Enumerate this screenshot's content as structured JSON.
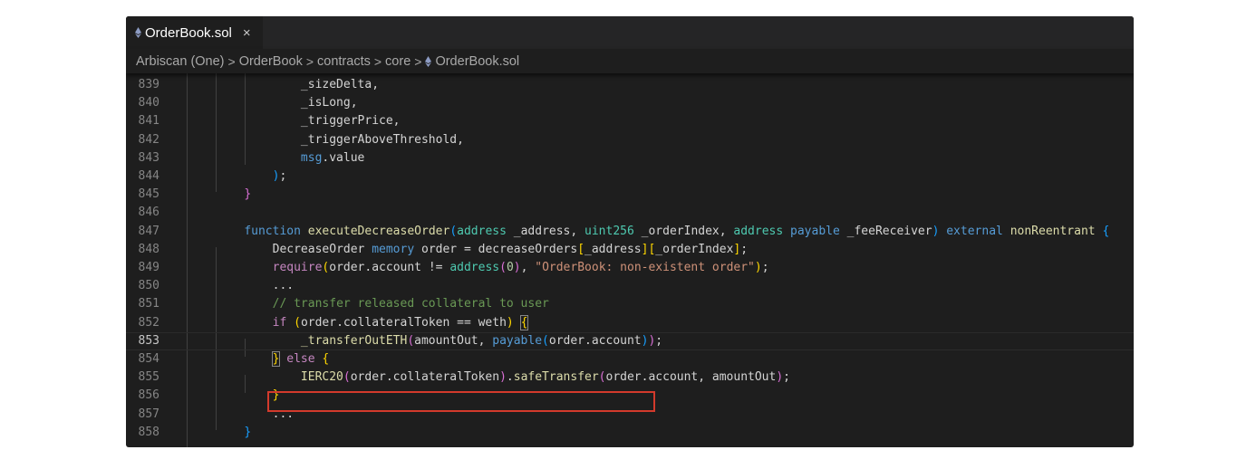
{
  "tab": {
    "filename": "OrderBook.sol",
    "close_glyph": "×",
    "icon": "ethereum-icon"
  },
  "breadcrumb": {
    "items": [
      "Arbiscan (One)",
      "OrderBook",
      "contracts",
      "core",
      "OrderBook.sol"
    ],
    "separator": ">"
  },
  "editor": {
    "current_line": 853,
    "lines": [
      {
        "n": "839",
        "indent": "            ",
        "tokens": [
          [
            "_sizeDelta",
            ""
          ],
          [
            ",",
            ""
          ]
        ]
      },
      {
        "n": "840",
        "indent": "            ",
        "tokens": [
          [
            "_isLong",
            ""
          ],
          [
            ",",
            ""
          ]
        ]
      },
      {
        "n": "841",
        "indent": "            ",
        "tokens": [
          [
            "_triggerPrice",
            ""
          ],
          [
            ",",
            ""
          ]
        ]
      },
      {
        "n": "842",
        "indent": "            ",
        "tokens": [
          [
            "_triggerAboveThreshold",
            ""
          ],
          [
            ",",
            ""
          ]
        ]
      },
      {
        "n": "843",
        "indent": "            ",
        "tokens": [
          [
            "msg",
            "kw"
          ],
          [
            ".value",
            ""
          ]
        ]
      },
      {
        "n": "844",
        "indent": "        ",
        "tokens": [
          [
            ")",
            "b3"
          ],
          [
            ";",
            ""
          ]
        ]
      },
      {
        "n": "845",
        "indent": "    ",
        "tokens": [
          [
            "}",
            "b2"
          ]
        ]
      },
      {
        "n": "846",
        "indent": "",
        "tokens": []
      },
      {
        "n": "847",
        "indent": "    ",
        "tokens": [
          [
            "function",
            "kw"
          ],
          [
            " ",
            ""
          ],
          [
            "executeDecreaseOrder",
            "fn"
          ],
          [
            "(",
            "b3"
          ],
          [
            "address",
            "ty"
          ],
          [
            " _address, ",
            ""
          ],
          [
            "uint256",
            "ty"
          ],
          [
            " _orderIndex, ",
            ""
          ],
          [
            "address",
            "ty"
          ],
          [
            " ",
            ""
          ],
          [
            "payable",
            "kw"
          ],
          [
            " _feeReceiver",
            ""
          ],
          [
            ")",
            "b3"
          ],
          [
            " ",
            ""
          ],
          [
            "external",
            "kw"
          ],
          [
            " ",
            ""
          ],
          [
            "nonReentrant",
            "fn"
          ],
          [
            " ",
            ""
          ],
          [
            "{",
            "b3"
          ]
        ]
      },
      {
        "n": "848",
        "indent": "        ",
        "tokens": [
          [
            "DecreaseOrder",
            ""
          ],
          [
            " ",
            ""
          ],
          [
            "memory",
            "kw"
          ],
          [
            " order = decreaseOrders",
            ""
          ],
          [
            "[",
            "b1"
          ],
          [
            "_address",
            ""
          ],
          [
            "]",
            "b1"
          ],
          [
            "[",
            "b1"
          ],
          [
            "_orderIndex",
            ""
          ],
          [
            "]",
            "b1"
          ],
          [
            ";",
            ""
          ]
        ]
      },
      {
        "n": "849",
        "indent": "        ",
        "tokens": [
          [
            "require",
            "ctl"
          ],
          [
            "(",
            "b1"
          ],
          [
            "order.account != ",
            ""
          ],
          [
            "address",
            "ty"
          ],
          [
            "(",
            "b2"
          ],
          [
            "0",
            "num"
          ],
          [
            ")",
            "b2"
          ],
          [
            ", ",
            ""
          ],
          [
            "\"OrderBook: non-existent order\"",
            "str"
          ],
          [
            ")",
            "b1"
          ],
          [
            ";",
            ""
          ]
        ]
      },
      {
        "n": "850",
        "indent": "        ",
        "tokens": [
          [
            "...",
            ""
          ]
        ]
      },
      {
        "n": "851",
        "indent": "        ",
        "tokens": [
          [
            "// transfer released collateral to user",
            "cm"
          ]
        ]
      },
      {
        "n": "852",
        "indent": "        ",
        "tokens": [
          [
            "if",
            "ctl"
          ],
          [
            " ",
            ""
          ],
          [
            "(",
            "b1"
          ],
          [
            "order.collateralToken == weth",
            ""
          ],
          [
            ")",
            "b1"
          ],
          [
            " ",
            ""
          ],
          [
            "{",
            "b1 bm"
          ]
        ]
      },
      {
        "n": "853",
        "indent": "            ",
        "tokens": [
          [
            "_transferOutETH",
            "fn"
          ],
          [
            "(",
            "b2"
          ],
          [
            "amountOut, ",
            ""
          ],
          [
            "payable",
            "kw"
          ],
          [
            "(",
            "b3"
          ],
          [
            "order.account",
            ""
          ],
          [
            ")",
            "b3"
          ],
          [
            ")",
            "b2"
          ],
          [
            ";",
            ""
          ]
        ]
      },
      {
        "n": "854",
        "indent": "        ",
        "tokens": [
          [
            "}",
            "b1 bm"
          ],
          [
            " ",
            ""
          ],
          [
            "else",
            "ctl"
          ],
          [
            " ",
            ""
          ],
          [
            "{",
            "b1"
          ]
        ]
      },
      {
        "n": "855",
        "indent": "            ",
        "tokens": [
          [
            "IERC20",
            "fn"
          ],
          [
            "(",
            "b2"
          ],
          [
            "order.collateralToken",
            ""
          ],
          [
            ")",
            "b2"
          ],
          [
            ".",
            ""
          ],
          [
            "safeTransfer",
            "fn"
          ],
          [
            "(",
            "b2"
          ],
          [
            "order.account, amountOut",
            ""
          ],
          [
            ")",
            "b2"
          ],
          [
            ";",
            ""
          ]
        ]
      },
      {
        "n": "856",
        "indent": "        ",
        "tokens": [
          [
            "}",
            "b1"
          ]
        ]
      },
      {
        "n": "857",
        "indent": "        ",
        "tokens": [
          [
            "...",
            ""
          ]
        ]
      },
      {
        "n": "858",
        "indent": "    ",
        "tokens": [
          [
            "}",
            "b3"
          ]
        ]
      }
    ]
  },
  "colors": {
    "highlight_box": "#d33a2c",
    "editor_background": "#1e1e1e",
    "tab_active_background": "#1e1e1e"
  }
}
